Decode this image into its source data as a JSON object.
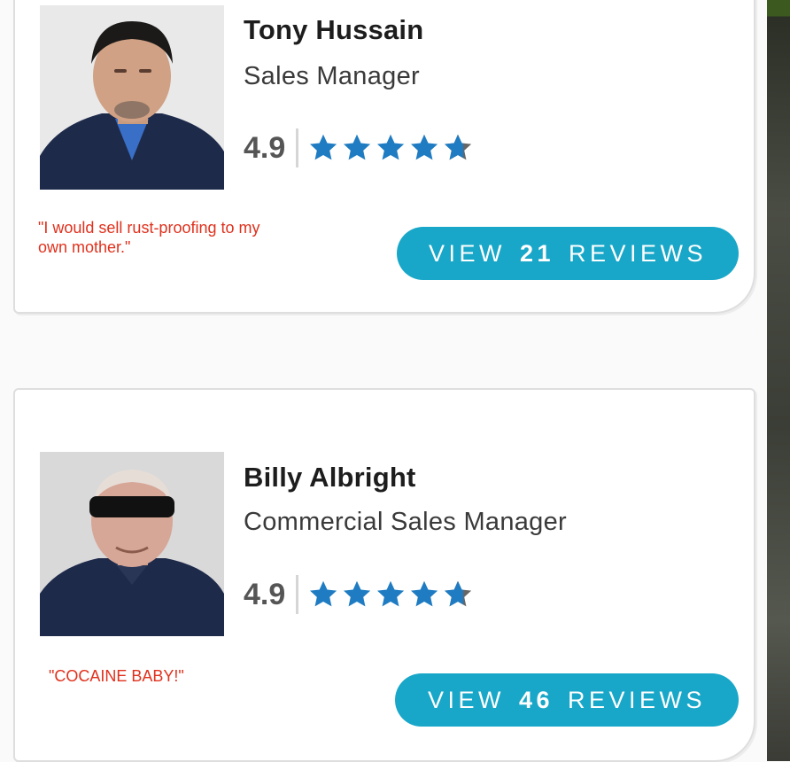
{
  "colors": {
    "button_bg": "#18a7c8",
    "star": "#1f7cc2",
    "quote": "#e0311d"
  },
  "profiles": [
    {
      "name": "Tony Hussain",
      "title": "Sales Manager",
      "rating": "4.9",
      "stars_value": 4.9,
      "quote": "\"I would sell rust-proofing to my own mother.\"",
      "button": {
        "view": "VIEW",
        "count": "21",
        "reviews": "REVIEWS"
      }
    },
    {
      "name": "Billy Albright",
      "title": "Commercial Sales Manager",
      "rating": "4.9",
      "stars_value": 4.9,
      "quote": "\"COCAINE BABY!\"",
      "button": {
        "view": "VIEW",
        "count": "46",
        "reviews": "REVIEWS"
      }
    }
  ]
}
